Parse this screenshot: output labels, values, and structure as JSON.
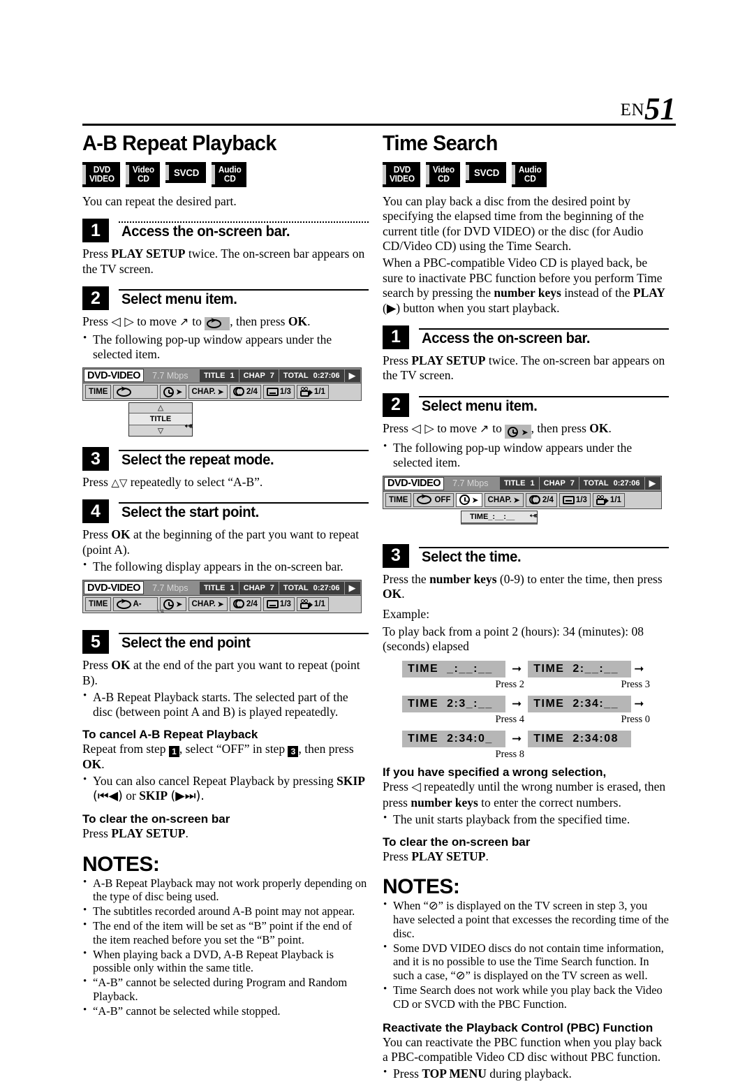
{
  "header": {
    "lang": "EN",
    "page_number": "51"
  },
  "left": {
    "title": "A-B Repeat Playback",
    "badges": [
      {
        "line1": "DVD",
        "line2": "VIDEO"
      },
      {
        "line1": "Video",
        "line2": "CD"
      },
      {
        "line1": "SVCD",
        "line2": ""
      },
      {
        "line1": "Audio",
        "line2": "CD"
      }
    ],
    "intro": "You can repeat the desired part.",
    "steps": [
      {
        "num": "1",
        "title": "Access the on-screen bar.",
        "body_pre": "Press ",
        "body_bold": "PLAY SETUP",
        "body_post": " twice. The on-screen bar appears on the TV screen."
      },
      {
        "num": "2",
        "title": "Select menu item.",
        "bullets": [
          "The following pop-up window appears under the selected item."
        ]
      },
      {
        "num": "3",
        "title": "Select the repeat mode.",
        "body": "repeatedly to select “A-B”."
      },
      {
        "num": "4",
        "title": "Select the start point.",
        "body": "at the beginning of the part you want to repeat (point A).",
        "bullets": [
          "The following display appears in the on-screen bar."
        ]
      },
      {
        "num": "5",
        "title": "Select the end point",
        "body": "at the end of the part you want to repeat (point B).",
        "bullets": [
          "A-B Repeat Playback starts. The selected part of the disc (between point A and B) is played repeatedly."
        ]
      }
    ],
    "osd1": {
      "disc": "DVD-VIDEO",
      "rate": "7.7 Mbps",
      "title_label": "TITLE",
      "title_value": "1",
      "chap_label": "CHAP",
      "chap_value": "7",
      "total_label": "TOTAL",
      "total_value": "0:27:06",
      "time_label": "TIME",
      "repeat_value": "",
      "chap_button": "CHAP.",
      "audio_value": "2/4",
      "subtitle_value": "1/3",
      "angle_value": "1/1",
      "popup": {
        "up": "△",
        "label": "TITLE",
        "down": "▽"
      }
    },
    "osd2": {
      "disc": "DVD-VIDEO",
      "rate": "7.7 Mbps",
      "title_label": "TITLE",
      "title_value": "1",
      "chap_label": "CHAP",
      "chap_value": "7",
      "total_label": "TOTAL",
      "total_value": "0:27:06",
      "time_label": "TIME",
      "repeat_value": "A-",
      "chap_button": "CHAP.",
      "audio_value": "2/4",
      "subtitle_value": "1/3",
      "angle_value": "1/1"
    },
    "cancel": {
      "heading": "To cancel A-B Repeat Playback",
      "body_a": "Repeat from step ",
      "step1": "1",
      "body_b": ", select “OFF” in step ",
      "step3": "3",
      "body_c": ", then press ",
      "ok": "OK",
      "body_d": ".",
      "bullet_a": "You can also cancel Repeat Playback by pressing ",
      "skip_bold": "SKIP",
      "skip1": "(⏮◀)",
      "bullet_b": " or ",
      "skip2": "(▶⏭)."
    },
    "clear": {
      "heading": "To clear the on-screen bar",
      "body_pre": "Press ",
      "body_bold": "PLAY SETUP",
      "body_post": "."
    },
    "notes_heading": "NOTES:",
    "notes": [
      "A-B Repeat Playback may not work properly depending on the type of disc being used.",
      "The subtitles recorded around A-B point may not appear.",
      "The end of the item will be set as “B” point if the end of the item reached before you set the “B” point.",
      "When playing back a DVD, A-B Repeat Playback is possible only within the same title.",
      "“A-B” cannot be selected during Program and Random Playback.",
      "“A-B” cannot be selected while stopped."
    ]
  },
  "right": {
    "title": "Time Search",
    "badges": [
      {
        "line1": "DVD",
        "line2": "VIDEO"
      },
      {
        "line1": "Video",
        "line2": "CD"
      },
      {
        "line1": "SVCD",
        "line2": ""
      },
      {
        "line1": "Audio",
        "line2": "CD"
      }
    ],
    "intro_a": "You can play back a disc from the desired point by specifying the elapsed time from the beginning of the current title (for DVD VIDEO) or the disc (for Audio CD/Video CD) using the Time Search.",
    "intro_b_1": "When a PBC-compatible Video CD is played back, be sure to inactivate PBC function before you perform Time search by pressing the ",
    "intro_b_bold1": "number keys",
    "intro_b_2": " instead of the ",
    "intro_b_bold2": "PLAY",
    "intro_b_3": " (▶) button when you start playback.",
    "steps": [
      {
        "num": "1",
        "title": "Access the on-screen bar.",
        "body_pre": "Press ",
        "body_bold": "PLAY SETUP",
        "body_post": " twice. The on-screen bar appears on the TV screen."
      },
      {
        "num": "2",
        "title": "Select menu item.",
        "bullets": [
          "The following pop-up window appears under the selected item."
        ]
      },
      {
        "num": "3",
        "title": "Select the time.",
        "body_pre": "Press the ",
        "body_bold": "number keys",
        "body_mid": " (0-9) to enter the time, then press ",
        "body_bold2": "OK",
        "body_post": ".",
        "example_label": "Example:",
        "example_text": "To play back from a point 2 (hours): 34 (minutes): 08 (seconds) elapsed"
      }
    ],
    "osd": {
      "disc": "DVD-VIDEO",
      "rate": "7.7 Mbps",
      "title_label": "TITLE",
      "title_value": "1",
      "chap_label": "CHAP",
      "chap_value": "7",
      "total_label": "TOTAL",
      "total_value": "0:27:06",
      "time_label": "TIME",
      "repeat_value": "OFF",
      "chap_button": "CHAP.",
      "audio_value": "2/4",
      "subtitle_value": "1/3",
      "angle_value": "1/1",
      "popup_time": "TIME_:__:__"
    },
    "time_sequence": [
      {
        "box1": "TIME  _:__:__",
        "box2": "TIME  2:__:__",
        "press1": "Press 2",
        "press2": "Press 3",
        "arrow_after": true
      },
      {
        "box1": "TIME  2:3_:__",
        "box2": "TIME  2:34:__",
        "press1": "Press 4",
        "press2": "Press 0",
        "arrow_after": true
      },
      {
        "box1": "TIME  2:34:0_",
        "box2": "TIME  2:34:08",
        "press1": "Press 8",
        "press2": "",
        "arrow_after": false
      }
    ],
    "wrong": {
      "heading": "If you have specified a wrong selection,",
      "body_a": "Press ",
      "body_b": " repeatedly until the wrong number is erased, then press ",
      "body_bold": "number keys",
      "body_c": " to enter the correct numbers.",
      "bullet": "The unit starts playback from the specified time."
    },
    "clear": {
      "heading": "To clear the on-screen bar",
      "body_pre": "Press ",
      "body_bold": "PLAY SETUP",
      "body_post": "."
    },
    "notes_heading": "NOTES:",
    "notes": [
      "When “⊘” is displayed on the TV screen in step 3, you have selected a point that excesses the recording time of the disc.",
      "Some DVD VIDEO discs do not contain time information, and it is no possible to use the Time Search function. In such a case, “⊘” is displayed on the TV screen as well.",
      "Time Search does not work while you play back the Video CD or SVCD with the PBC Function."
    ],
    "pbc": {
      "heading": "Reactivate the Playback Control (PBC) Function",
      "body": "You can reactivate the PBC function when you play back a PBC-compatible Video CD disc without PBC function.",
      "bullet_pre": "Press ",
      "bullet_bold": "TOP MENU",
      "bullet_post": " during playback."
    }
  },
  "shared": {
    "press": "Press",
    "to_move": "to move",
    "to": "to",
    "then_press": ", then press",
    "ok": "OK",
    "arrows_lr": "◁ ▷",
    "arrows_ud": "△▽",
    "cursor": "↖"
  }
}
